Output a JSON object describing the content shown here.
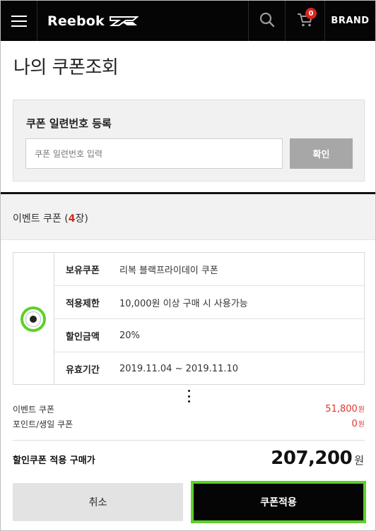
{
  "header": {
    "logo_text": "Reebok",
    "cart_count": "0",
    "brand_label": "BRAND"
  },
  "page": {
    "title": "나의 쿠폰조회"
  },
  "register": {
    "title": "쿠폰 일련번호 등록",
    "placeholder": "쿠폰 일련번호 입력",
    "confirm_label": "확인"
  },
  "event": {
    "label_prefix": "이벤트 쿠폰 (",
    "count": "4",
    "label_suffix": "장)"
  },
  "coupon": {
    "selected": true,
    "rows": [
      {
        "label": "보유쿠폰",
        "value": "리복 블랙프라이데이 쿠폰"
      },
      {
        "label": "적용제한",
        "value": "10,000원 이상 구매 시 사용가능"
      },
      {
        "label": "할인금액",
        "value": "20%"
      },
      {
        "label": "유효기간",
        "value": "2019.11.04 ~ 2019.11.10"
      }
    ]
  },
  "summary": {
    "event_coupon_label": "이벤트 쿠폰",
    "event_coupon_amount": "51,800",
    "point_coupon_label": "포인트/생일 쿠폰",
    "point_coupon_amount": "0",
    "unit": "원",
    "total_label": "할인쿠폰 적용 구매가",
    "total_amount": "207,200",
    "total_unit": "원"
  },
  "actions": {
    "cancel_label": "취소",
    "apply_label": "쿠폰적용"
  },
  "colors": {
    "accent_red": "#d9251c",
    "highlight_green": "#5cd12a",
    "header_bg": "#050505"
  }
}
